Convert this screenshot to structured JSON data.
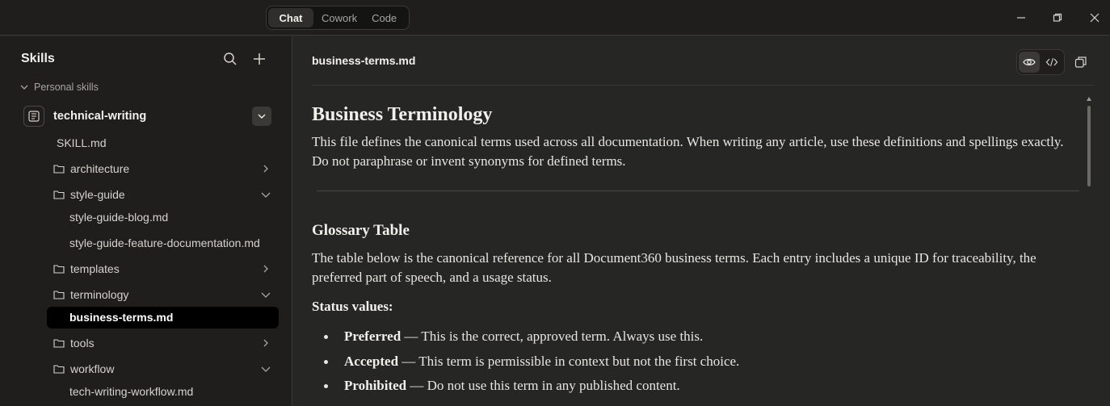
{
  "titlebar": {
    "tabs": [
      {
        "label": "Chat",
        "active": true
      },
      {
        "label": "Cowork",
        "active": false
      },
      {
        "label": "Code",
        "active": false
      }
    ]
  },
  "sidebar": {
    "title": "Skills",
    "section_label": "Personal skills",
    "skill": {
      "name": "technical-writing"
    },
    "items": [
      {
        "label": "SKILL.md",
        "type": "file"
      },
      {
        "label": "architecture",
        "type": "folder",
        "state": "collapsed"
      },
      {
        "label": "style-guide",
        "type": "folder",
        "state": "expanded"
      },
      {
        "label": "style-guide-blog.md",
        "type": "file"
      },
      {
        "label": "style-guide-feature-documentation.md",
        "type": "file"
      },
      {
        "label": "templates",
        "type": "folder",
        "state": "collapsed"
      },
      {
        "label": "terminology",
        "type": "folder",
        "state": "expanded"
      },
      {
        "label": "business-terms.md",
        "type": "file",
        "selected": true
      },
      {
        "label": "tools",
        "type": "folder",
        "state": "collapsed"
      },
      {
        "label": "workflow",
        "type": "folder",
        "state": "expanded"
      },
      {
        "label": "tech-writing-workflow.md",
        "type": "file"
      }
    ]
  },
  "main": {
    "file_title": "business-terms.md",
    "view_modes": [
      "preview",
      "code"
    ],
    "active_view": "preview",
    "doc": {
      "h1": "Business Terminology",
      "intro": "This file defines the canonical terms used across all documentation. When writing any article, use these definitions and spellings exactly. Do not paraphrase or invent synonyms for defined terms.",
      "h2": "Glossary Table",
      "table_intro": "The table below is the canonical reference for all Document360 business terms. Each entry includes a unique ID for traceability, the preferred part of speech, and a usage status.",
      "status_heading": "Status values:",
      "statuses": [
        {
          "term": "Preferred",
          "desc": " — This is the correct, approved term. Always use this."
        },
        {
          "term": "Accepted",
          "desc": " — This term is permissible in context but not the first choice."
        },
        {
          "term": "Prohibited",
          "desc": " — Do not use this term in any published content."
        }
      ]
    }
  },
  "colors": {
    "background": "#262624",
    "sidebar": "#1f1e1d",
    "selected_row": "#000000",
    "text": "#e8e6e1"
  }
}
